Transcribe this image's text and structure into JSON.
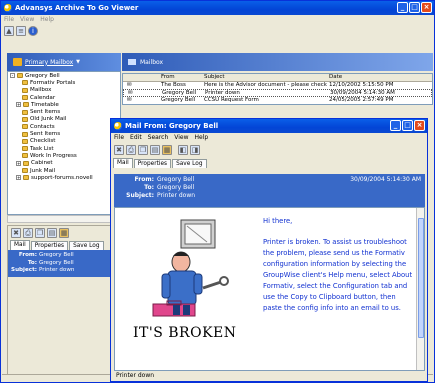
{
  "app": {
    "title": "Advansys Archive To Go Viewer",
    "menu": [
      "File",
      "View",
      "Help"
    ]
  },
  "left_panel": {
    "header_link": "Primary Mailbox",
    "tree": [
      {
        "label": "Gregory Bell",
        "indent": 0,
        "expander": "-"
      },
      {
        "label": "Formativ Portals",
        "indent": 2
      },
      {
        "label": "Mailbox",
        "indent": 2
      },
      {
        "label": "Calendar",
        "indent": 2
      },
      {
        "label": "Timetable",
        "indent": 1,
        "expander": "+"
      },
      {
        "label": "Sent Items",
        "indent": 2
      },
      {
        "label": "Old Junk Mail",
        "indent": 2
      },
      {
        "label": "Contacts",
        "indent": 2
      },
      {
        "label": "Sent Items",
        "indent": 2
      },
      {
        "label": "Checklist",
        "indent": 2
      },
      {
        "label": "Task List",
        "indent": 2
      },
      {
        "label": "Work In Progress",
        "indent": 2
      },
      {
        "label": "Cabinet",
        "indent": 1,
        "expander": "+"
      },
      {
        "label": "Junk Mail",
        "indent": 2
      },
      {
        "label": "support-forums.novell",
        "indent": 1,
        "expander": "+"
      }
    ],
    "tabs": [
      "Mail",
      "Properties",
      "Save Log"
    ],
    "preview": {
      "from_label": "From:",
      "from": "Gregory Bell",
      "to_label": "To:",
      "to": "Gregory Bell",
      "subject_label": "Subject:",
      "subject": "Printer down"
    }
  },
  "mailbox": {
    "header": "Mailbox",
    "columns": [
      "",
      "From",
      "Subject",
      "Date"
    ],
    "rows": [
      {
        "from": "The Boss",
        "subject": "Here is the Advisor document - please check",
        "date": "12/10/2002 5:15:50 PM"
      },
      {
        "from": "Gregory Bell",
        "subject": "Printer down",
        "date": "30/09/2004 5:14:30 AM"
      },
      {
        "from": "Gregory Bell",
        "subject": "CCSU Request Form",
        "date": "24/05/2005 2:57:49 PM"
      }
    ]
  },
  "mail_window": {
    "title": "Mail From: Gregory Bell",
    "menu": [
      "File",
      "Edit",
      "Search",
      "View",
      "Help"
    ],
    "tabs": [
      "Mail",
      "Properties",
      "Save Log"
    ],
    "from_label": "From:",
    "from": "Gregory Bell",
    "to_label": "To:",
    "to": "Gregory Bell",
    "subject_label": "Subject:",
    "subject": "Printer down",
    "date": "30/09/2004 5:14:30 AM",
    "image_caption": "IT'S BROKEN",
    "body_greeting": "Hi there,",
    "body_text": "Printer is broken.  To assist us troubleshoot the problem, please send us the Formativ configuration information by selecting the GroupWise client's Help menu, select About Formativ, select the Configuration tab and use the Copy to Clipboard button, then paste the config info into an email to us.",
    "status": "Printer down"
  },
  "colors": {
    "titlebar": "#0345d6",
    "header_blue": "#3969c7",
    "body_text": "#1030d0"
  }
}
